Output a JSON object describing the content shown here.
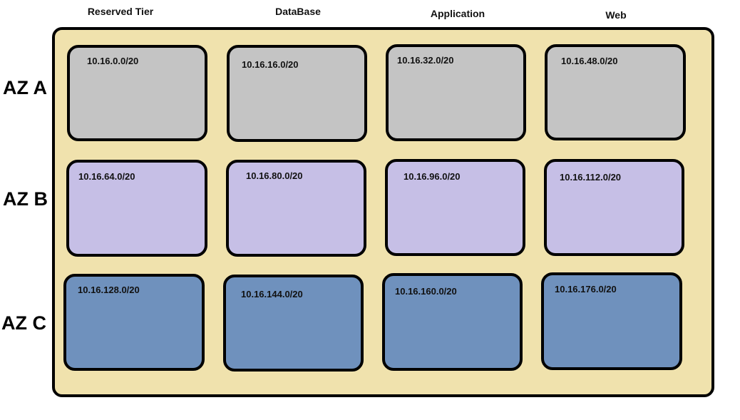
{
  "columns": [
    {
      "label": "Reserved Tier"
    },
    {
      "label": "DataBase"
    },
    {
      "label": "Application"
    },
    {
      "label": "Web"
    }
  ],
  "rows": [
    {
      "label": "AZ A",
      "color": "#c4c4c4"
    },
    {
      "label": "AZ B",
      "color": "#c6bfe6"
    },
    {
      "label": "AZ C",
      "color": "#6f91bd"
    }
  ],
  "vpc": {
    "color": "#f0e2ad"
  },
  "subnets": [
    [
      "10.16.0.0/20",
      "10.16.16.0/20",
      "10.16.32.0/20",
      "10.16.48.0/20"
    ],
    [
      "10.16.64.0/20",
      "10.16.80.0/20",
      "10.16.96.0/20",
      "10.16.112.0/20"
    ],
    [
      "10.16.128.0/20",
      "10.16.144.0/20",
      "10.16.160.0/20",
      "10.16.176.0/20"
    ]
  ]
}
